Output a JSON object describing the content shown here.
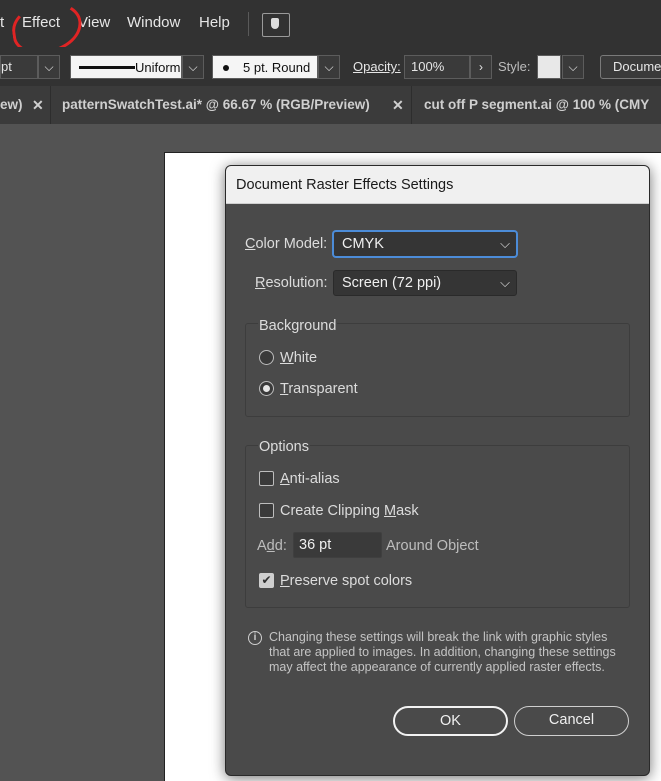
{
  "menubar": {
    "items": [
      "t",
      "Effect",
      "View",
      "Window",
      "Help"
    ]
  },
  "controlbar": {
    "stroke_weight": "pt",
    "stroke_profile": "Uniform",
    "brush": "5 pt. Round",
    "opacity_label": "Opacity:",
    "opacity_value": "100%",
    "style_label": "Style:",
    "document_button": "Documer"
  },
  "tabs": [
    {
      "label": "ew)"
    },
    {
      "label": "patternSwatchTest.ai* @ 66.67 % (RGB/Preview)"
    },
    {
      "label": "cut off P segment.ai @ 100 % (CMY"
    }
  ],
  "dialog": {
    "title": "Document Raster Effects Settings",
    "color_model": {
      "label_u": "C",
      "label_rest": "olor Model:",
      "value": "CMYK"
    },
    "resolution": {
      "label_u": "R",
      "label_rest": "esolution:",
      "value": "Screen (72 ppi)"
    },
    "background": {
      "title": "Background",
      "white": {
        "u": "W",
        "rest": "hite"
      },
      "transparent": {
        "u": "T",
        "rest": "ransparent"
      }
    },
    "options": {
      "title": "Options",
      "anti_alias": {
        "u": "A",
        "rest": "nti-alias"
      },
      "clipping_mask": {
        "before": "Create Clipping ",
        "u": "M",
        "rest": "ask"
      },
      "add_label": {
        "before": "A",
        "u": "d",
        "rest": "d:"
      },
      "add_value": "36 pt",
      "around_object": "Around Object",
      "preserve_spot": {
        "u": "P",
        "rest": "reserve spot colors"
      }
    },
    "info": {
      "line1": "Changing these settings will break the link with graphic styles",
      "line2": "that are applied to images. In addition, changing these settings",
      "line3": "may affect the appearance of currently applied raster effects."
    },
    "ok_label": "OK",
    "cancel_label": "Cancel"
  },
  "colors": {
    "annotation_circle": "#e02424",
    "focus_blue": "#4c8cd8"
  }
}
